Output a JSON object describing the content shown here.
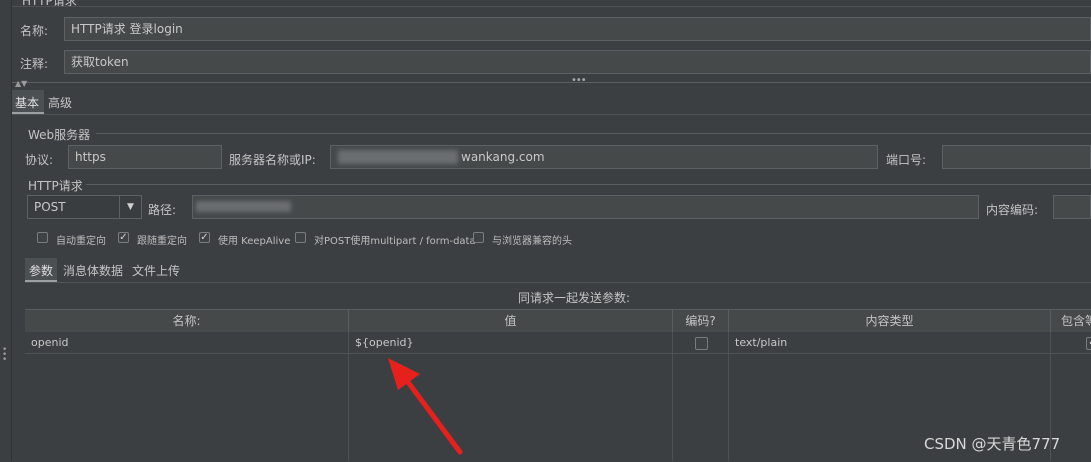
{
  "header": {
    "title": "HTTP请求"
  },
  "name_row": {
    "label": "名称:",
    "value": "HTTP请求 登录login"
  },
  "comment_row": {
    "label": "注释:",
    "value": "获取token"
  },
  "splitter": {
    "grip": "•••"
  },
  "main_tabs": [
    {
      "label": "基本"
    },
    {
      "label": "高级"
    }
  ],
  "web_server": {
    "section_label": "Web服务器",
    "protocol_label": "协议:",
    "protocol_value": "https",
    "server_label": "服务器名称或IP:",
    "server_value_visible": "wankang.com",
    "port_label": "端口号:",
    "port_value": ""
  },
  "http_request": {
    "section_label": "HTTP请求",
    "method": "POST",
    "path_label": "路径:",
    "encoding_label": "内容编码:",
    "encoding_value": ""
  },
  "options": [
    {
      "label": "自动重定向",
      "checked": false
    },
    {
      "label": "跟随重定向",
      "checked": true
    },
    {
      "label": "使用 KeepAlive",
      "checked": true
    },
    {
      "label": "对POST使用multipart / form-data",
      "checked": false
    },
    {
      "label": "与浏览器兼容的头",
      "checked": false
    }
  ],
  "sub_tabs": [
    {
      "label": "参数"
    },
    {
      "label": "消息体数据"
    },
    {
      "label": "文件上传"
    }
  ],
  "params_table": {
    "caption": "同请求一起发送参数:",
    "headers": [
      "名称:",
      "值",
      "编码?",
      "内容类型",
      "包含等"
    ],
    "rows": [
      {
        "name": "openid",
        "value": "${openid}",
        "encode": false,
        "content_type": "text/plain",
        "include_equals": true
      }
    ]
  },
  "watermark": "CSDN @天青色777",
  "colors": {
    "background": "#3c3f41",
    "field": "#45494a",
    "arrow": "#e8201c"
  }
}
